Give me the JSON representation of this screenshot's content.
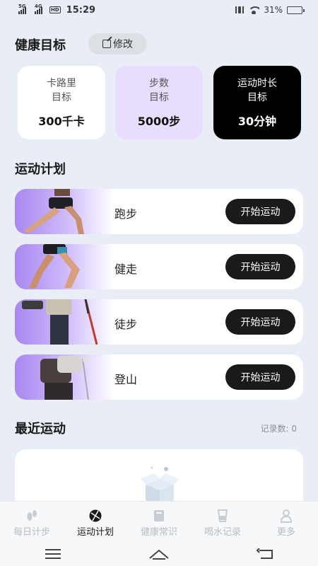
{
  "status": {
    "time": "15:29",
    "battery": "31%",
    "sig1": "5G",
    "sig2": "4G",
    "hd": "HD"
  },
  "goals": {
    "title": "健康目标",
    "edit_label": "修改",
    "cards": [
      {
        "label_line1": "卡路里",
        "label_line2": "目标",
        "value": "300千卡"
      },
      {
        "label_line1": "步数",
        "label_line2": "目标",
        "value": "5000步"
      },
      {
        "label_line1": "运动时长",
        "label_line2": "目标",
        "value": "30分钟"
      }
    ]
  },
  "plan": {
    "title": "运动计划",
    "items": [
      {
        "name": "跑步",
        "button": "开始运动"
      },
      {
        "name": "健走",
        "button": "开始运动"
      },
      {
        "name": "徒步",
        "button": "开始运动"
      },
      {
        "name": "登山",
        "button": "开始运动"
      }
    ]
  },
  "recent": {
    "title": "最近运动",
    "count_label": "记录数: 0"
  },
  "tabs": [
    {
      "label": "每日计步",
      "icon": "footprint-icon"
    },
    {
      "label": "运动计划",
      "icon": "ball-icon"
    },
    {
      "label": "健康常识",
      "icon": "book-icon"
    },
    {
      "label": "喝水记录",
      "icon": "cup-icon"
    },
    {
      "label": "更多",
      "icon": "person-icon"
    }
  ],
  "active_tab": 1
}
